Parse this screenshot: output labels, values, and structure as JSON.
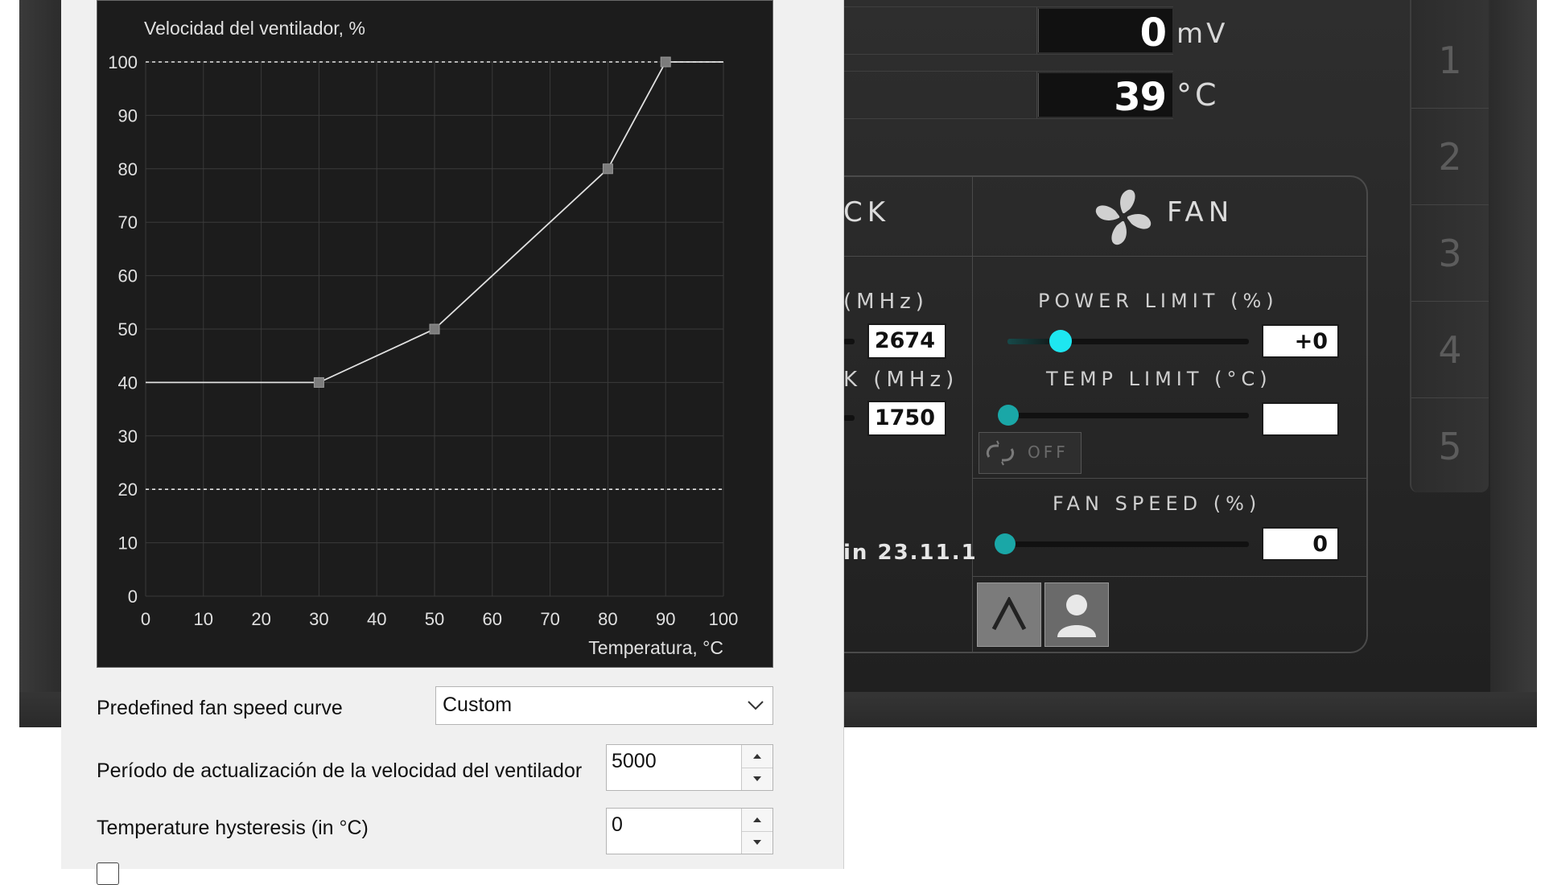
{
  "dialog": {
    "predefined_label": "Predefined fan speed curve",
    "predefined_value": "Custom",
    "period_label": "Período de actualización de la velocidad del ventilador",
    "period_value": "5000",
    "hysteresis_label": "Temperature hysteresis (in °C)",
    "hysteresis_value": "0"
  },
  "chart_data": {
    "type": "line",
    "title": "",
    "ylabel": "Velocidad del ventilador, %",
    "xlabel": "Temperatura, °C",
    "xlim": [
      0,
      100
    ],
    "ylim": [
      0,
      100
    ],
    "xticks": [
      0,
      10,
      20,
      30,
      40,
      50,
      60,
      70,
      80,
      90,
      100
    ],
    "yticks": [
      0,
      10,
      20,
      30,
      40,
      50,
      60,
      70,
      80,
      90,
      100
    ],
    "grid": true,
    "series": [
      {
        "x": [
          0,
          30,
          50,
          80,
          90,
          100
        ],
        "y": [
          40,
          40,
          50,
          80,
          100,
          100
        ],
        "control_points_x": [
          30,
          50,
          80,
          90
        ],
        "control_points_y": [
          40,
          50,
          80,
          100
        ]
      }
    ],
    "limit_lines_y": [
      100,
      20
    ],
    "colors": {
      "background": "#1c1c1c",
      "grid": "#3a3a3a",
      "line": "#e0e0e0",
      "point": "#7c7c7c",
      "text": "#e0e0e0"
    }
  },
  "skin": {
    "voltage_value": "0",
    "voltage_unit": "mV",
    "temp_value": "39",
    "temp_unit": "°C",
    "clock_title": "CK",
    "fan_title": "FAN",
    "core_clock_label": "(MHz)",
    "core_clock_value": "2674",
    "mem_clock_label": "K (MHz)",
    "mem_clock_value": "1750",
    "power_limit_label": "POWER LIMIT (%)",
    "power_limit_value": "+0",
    "temp_limit_label": "TEMP LIMIT (°C)",
    "temp_limit_value": "",
    "off_label": "OFF",
    "fan_speed_label": "FAN SPEED (%)",
    "fan_speed_value": "0",
    "version": "in 23.11.1",
    "tabs": [
      "1",
      "2",
      "3",
      "4",
      "5"
    ],
    "accent": "#1ee6f0",
    "thumb_dim": "#1aa7a7"
  }
}
